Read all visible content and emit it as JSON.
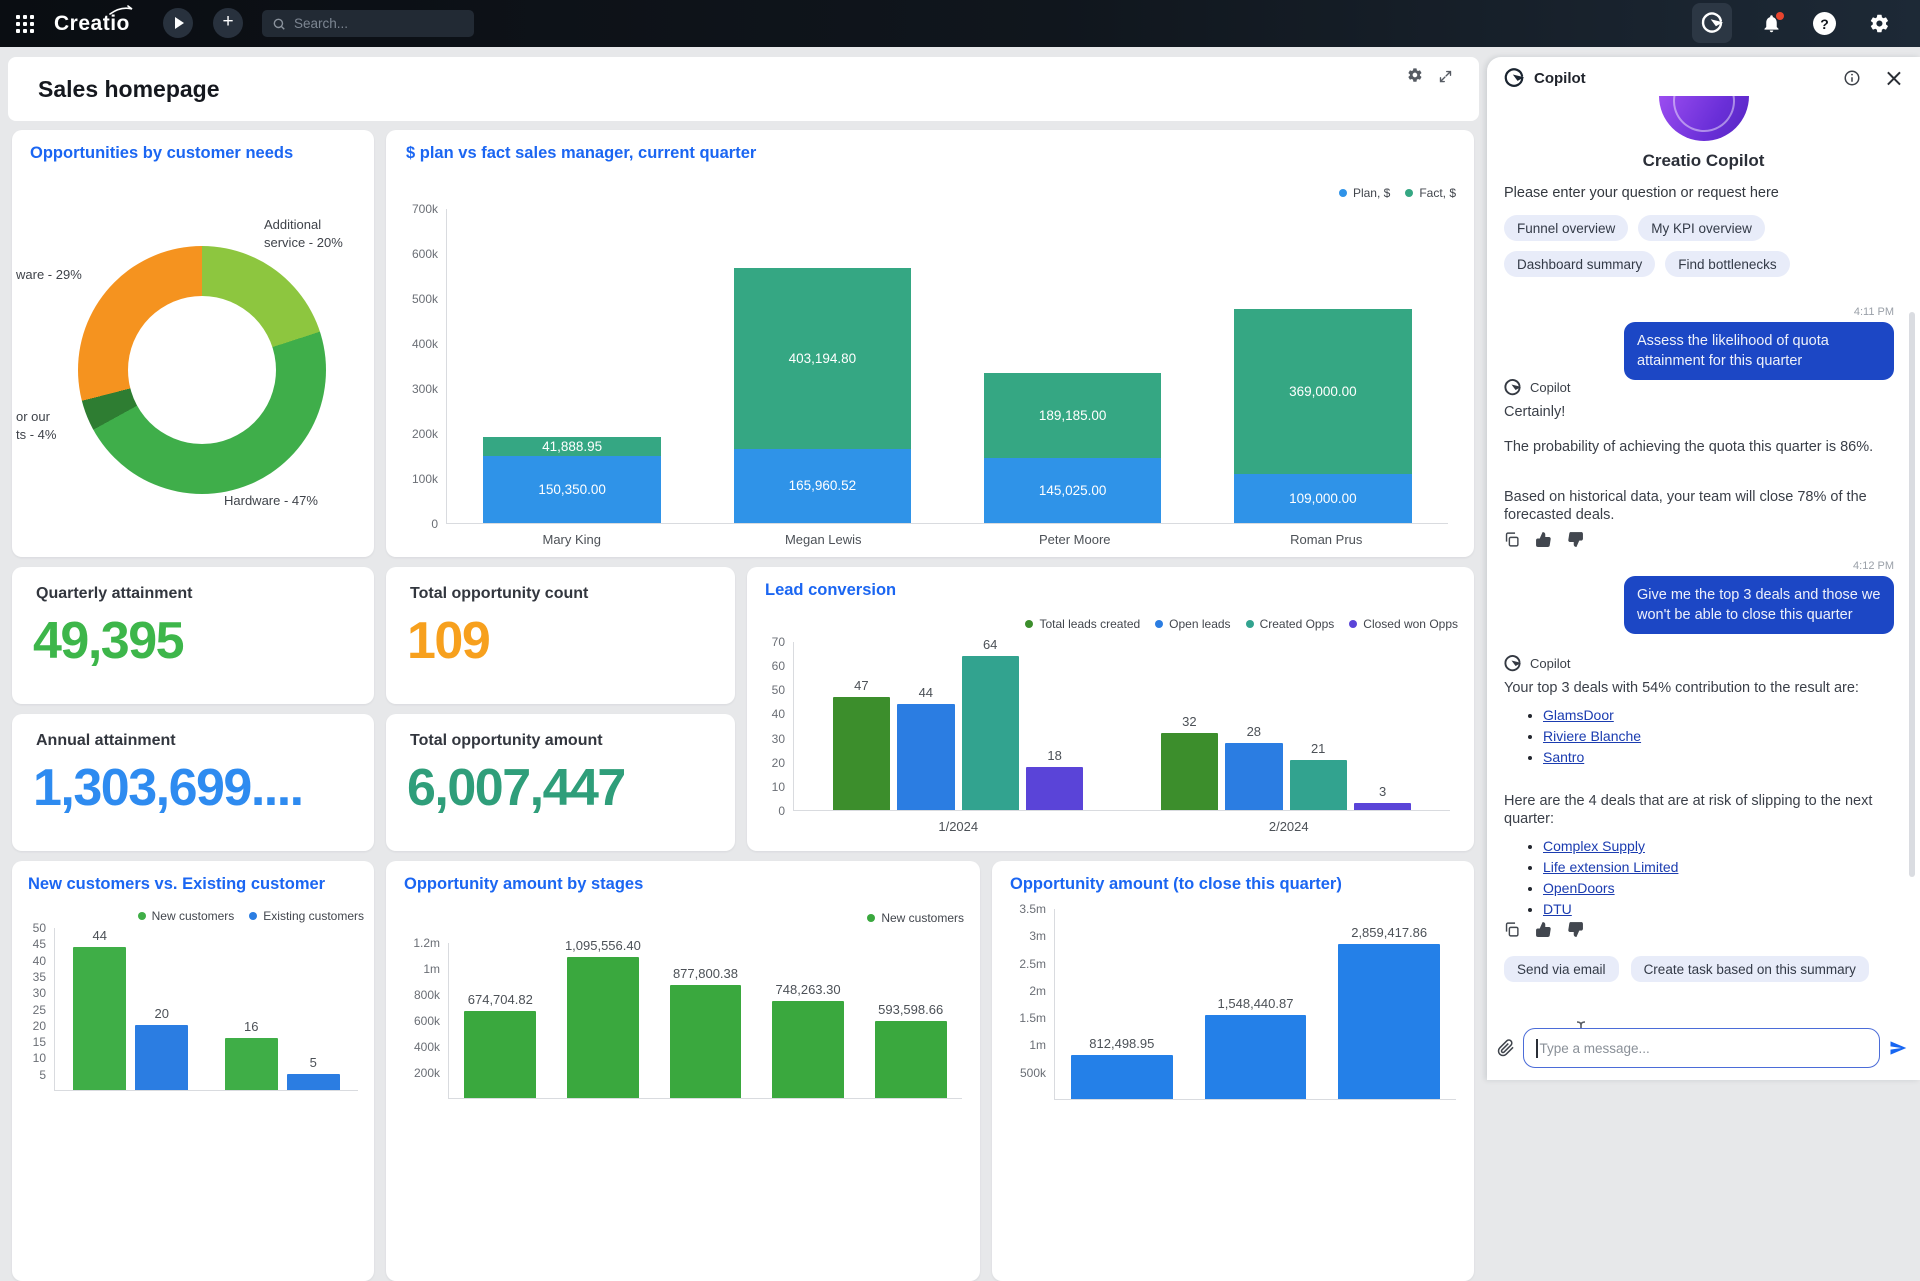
{
  "topbar": {
    "logo": "Creatio",
    "search_placeholder": "Search..."
  },
  "dashboard": {
    "title": "Sales homepage"
  },
  "kpis": [
    {
      "label": "Quarterly attainment",
      "value": "49,395",
      "color": "#3db64a"
    },
    {
      "label": "Total opportunity count",
      "value": "109",
      "color": "#f7a01d"
    },
    {
      "label": "Annual attainment",
      "value": "1,303,699....",
      "color": "#2e8bf0"
    },
    {
      "label": "Total opportunity amount",
      "value": "6,007,447",
      "color": "#2f9e7a"
    }
  ],
  "chart_data": [
    {
      "id": "opps_by_needs",
      "type": "donut",
      "title": "Opportunities by customer needs",
      "slices": [
        {
          "label": "Additional\nservice - 20%",
          "value": 20,
          "color": "#8dc63f"
        },
        {
          "label": "Hardware - 47%",
          "value": 47,
          "color": "#3fae4a"
        },
        {
          "label": "or our\nts - 4%",
          "value": 4,
          "color": "#2e7d32"
        },
        {
          "label": "ware - 29%",
          "value": 29,
          "color": "#f5931f"
        }
      ]
    },
    {
      "id": "plan_vs_fact",
      "type": "bar",
      "stacked": true,
      "title": "$ plan vs fact sales manager, current quarter",
      "categories": [
        "Mary King",
        "Megan Lewis",
        "Peter Moore",
        "Roman Prus"
      ],
      "series": [
        {
          "name": "Plan, $",
          "color": "#2f93e8",
          "values": [
            150350.0,
            165960.52,
            145025.0,
            109000.0
          ],
          "labels": [
            "150,350.00",
            "165,960.52",
            "145,025.00",
            "109,000.00"
          ]
        },
        {
          "name": "Fact, $",
          "color": "#35a783",
          "values": [
            41888.95,
            403194.8,
            189185.0,
            369000.0
          ],
          "labels": [
            "41,888.95",
            "403,194.80",
            "189,185.00",
            "369,000.00"
          ]
        }
      ],
      "ylim": [
        0,
        700000
      ],
      "yticks": [
        {
          "v": 0,
          "t": "0"
        },
        {
          "v": 100000,
          "t": "100k"
        },
        {
          "v": 200000,
          "t": "200k"
        },
        {
          "v": 300000,
          "t": "300k"
        },
        {
          "v": 400000,
          "t": "400k"
        },
        {
          "v": 500000,
          "t": "500k"
        },
        {
          "v": 600000,
          "t": "600k"
        },
        {
          "v": 700000,
          "t": "700k"
        }
      ]
    },
    {
      "id": "lead_conversion",
      "type": "bar",
      "title": "Lead conversion",
      "categories": [
        "1/2024",
        "2/2024"
      ],
      "series": [
        {
          "name": "Total leads created",
          "color": "#3c8e2c",
          "values": [
            47,
            32
          ]
        },
        {
          "name": "Open leads",
          "color": "#2b7de2",
          "values": [
            44,
            28
          ]
        },
        {
          "name": "Created Opps",
          "color": "#32a38f",
          "values": [
            64,
            21
          ]
        },
        {
          "name": "Closed won Opps",
          "color": "#5a44d8",
          "values": [
            18,
            3
          ]
        }
      ],
      "ylim": [
        0,
        70
      ],
      "yticks": [
        {
          "v": 0,
          "t": "0"
        },
        {
          "v": 10,
          "t": "10"
        },
        {
          "v": 20,
          "t": "20"
        },
        {
          "v": 30,
          "t": "30"
        },
        {
          "v": 40,
          "t": "40"
        },
        {
          "v": 50,
          "t": "50"
        },
        {
          "v": 60,
          "t": "60"
        },
        {
          "v": 70,
          "t": "70"
        }
      ],
      "value_labels": true
    },
    {
      "id": "new_vs_existing",
      "type": "bar",
      "title": "New customers vs. Existing customer",
      "categories": [
        "",
        ""
      ],
      "series": [
        {
          "name": "New customers",
          "color": "#3fae47",
          "values": [
            44,
            16
          ]
        },
        {
          "name": "Existing customers",
          "color": "#2b7de2",
          "values": [
            20,
            5
          ]
        }
      ],
      "ylim": [
        0,
        50
      ],
      "yticks": [
        {
          "v": 5,
          "t": "5"
        },
        {
          "v": 10,
          "t": "10"
        },
        {
          "v": 15,
          "t": "15"
        },
        {
          "v": 20,
          "t": "20"
        },
        {
          "v": 25,
          "t": "25"
        },
        {
          "v": 30,
          "t": "30"
        },
        {
          "v": 35,
          "t": "35"
        },
        {
          "v": 40,
          "t": "40"
        },
        {
          "v": 45,
          "t": "45"
        },
        {
          "v": 50,
          "t": "50"
        }
      ],
      "value_labels": true
    },
    {
      "id": "opp_by_stages",
      "type": "bar",
      "title": "Opportunity amount by stages",
      "categories": [
        "",
        "",
        "",
        "",
        ""
      ],
      "series": [
        {
          "name": "New customers",
          "color": "#3aa83e",
          "values": [
            674704.82,
            1095556.4,
            877800.38,
            748263.3,
            593598.66
          ],
          "labels": [
            "674,704.82",
            "1,095,556.40",
            "877,800.38",
            "748,263.30",
            "593,598.66"
          ]
        }
      ],
      "ylim": [
        0,
        1200000
      ],
      "yticks": [
        {
          "v": 200000,
          "t": "200k"
        },
        {
          "v": 400000,
          "t": "400k"
        },
        {
          "v": 600000,
          "t": "600k"
        },
        {
          "v": 800000,
          "t": "800k"
        },
        {
          "v": 1000000,
          "t": "1m"
        },
        {
          "v": 1200000,
          "t": "1.2m"
        }
      ],
      "value_labels": true
    },
    {
      "id": "opp_to_close",
      "type": "bar",
      "title": "Opportunity amount (to close this quarter)",
      "categories": [
        "",
        "",
        ""
      ],
      "series": [
        {
          "name": "",
          "color": "#2480e8",
          "values": [
            812498.95,
            1548440.87,
            2859417.86
          ],
          "labels": [
            "812,498.95",
            "1,548,440.87",
            "2,859,417.86"
          ]
        }
      ],
      "ylim": [
        0,
        3500000
      ],
      "yticks": [
        {
          "v": 500000,
          "t": "500k"
        },
        {
          "v": 1000000,
          "t": "1m"
        },
        {
          "v": 1500000,
          "t": "1.5m"
        },
        {
          "v": 2000000,
          "t": "2m"
        },
        {
          "v": 2500000,
          "t": "2.5m"
        },
        {
          "v": 3000000,
          "t": "3m"
        },
        {
          "v": 3500000,
          "t": "3.5m"
        }
      ],
      "value_labels": true
    }
  ],
  "copilot": {
    "title": "Copilot",
    "intro_title": "Creatio Copilot",
    "intro_subtitle": "Please enter your question or request here",
    "suggestions": [
      "Funnel overview",
      "My KPI overview",
      "Dashboard summary",
      "Find bottlenecks"
    ],
    "messages": {
      "time1": "4:11 PM",
      "user1": "Assess the likelihood of quota attainment for this quarter",
      "bot_label": "Copilot",
      "bot1_p1": "Certainly!",
      "bot1_p2": "The probability of achieving the quota this quarter is 86%.",
      "bot1_p3": "Based on historical data, your team will close 78% of the forecasted deals.",
      "time2": "4:12 PM",
      "user2": "Give me the top 3 deals and those we won't be able to close this quarter",
      "bot2_p1": "Your top 3 deals with 54% contribution to the result are:",
      "top_deals": [
        "GlamsDoor",
        "Riviere Blanche",
        "Santro"
      ],
      "bot2_p2": "Here are the 4 deals that are at risk of slipping to the next quarter:",
      "risk_deals": [
        "Complex Supply",
        "Life extension Limited",
        "OpenDoors",
        "DTU"
      ]
    },
    "actions": [
      "Send via email",
      "Create task based on this summary"
    ],
    "input_placeholder": "Type a message..."
  }
}
